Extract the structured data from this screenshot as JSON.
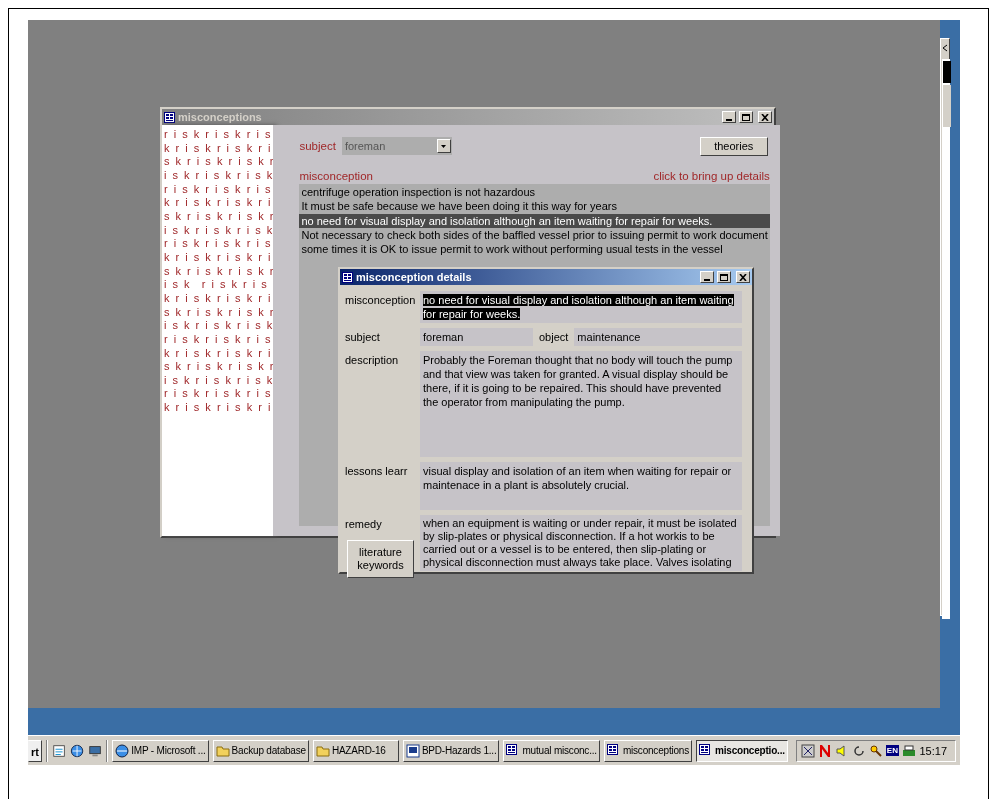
{
  "misconceptions_window": {
    "title": "misconceptions",
    "risk_pattern": [
      "r i s k r i s k r i s",
      "k r i s k r i s k r i",
      "s k r i s k r i s k r",
      "i s k r i s k r i s k",
      "r i s k r i s k r i s",
      "k r i s k r i s k r i",
      "s k r i s k r i s k r",
      "i s k r i s k r i s k",
      "r i s k r i s k r i s",
      "k r i s k r i s k r i",
      "s k r i s k r i s k r",
      "i s k  r i s k r i s",
      "k r i s k r i s k r i",
      "s k r i s k r i s k r",
      "i s k r i s k r i s k",
      "r i s k r i s k r i s",
      "k r i s k r i s k r i",
      "s k r i s k r i s k r",
      "i s k r i s k r i s k",
      "r i s k r i s k r i s",
      "k r i s k r i s k r i"
    ],
    "subject_label": "subject",
    "subject_value": "foreman",
    "theories_button": "theories",
    "misconception_label": "misconception",
    "details_hint": "click to bring up details",
    "items": [
      {
        "text": "centrifuge operation inspection is not hazardous",
        "selected": false
      },
      {
        "text": "It must be safe because we have been doing it this way for years",
        "selected": false
      },
      {
        "text": "no need for visual display and isolation although an item waiting for repair for weeks.",
        "selected": true
      },
      {
        "text": "Not necessary to check both sides of the baffled vessel prior to issuing permit to work document",
        "selected": false
      },
      {
        "text": "some times it is OK to issue permit to work without performing usual tests in the vessel",
        "selected": false
      }
    ]
  },
  "details_window": {
    "title": "misconception details",
    "misconception": {
      "label": "misconception",
      "value": "no need for visual display and isolation although an item waiting for repair for weeks.",
      "highlighted": true
    },
    "subject": {
      "label": "subject",
      "value": "foreman"
    },
    "object": {
      "label": "object",
      "value": "maintenance"
    },
    "description": {
      "label": "description",
      "value": "Probably the Foreman thought that no body will touch the pump and that view was taken for granted. A visual display should be there, if it is going to be repaired. This should have prevented the operator from manipulating the pump."
    },
    "lessons": {
      "label": "lessons learr",
      "value": "visual display and isolation of an item when waiting for repair or maintenace in a plant is absolutely crucial."
    },
    "remedy": {
      "label": "remedy",
      "value": "when an equipment is waiting or under repair, it must be isolated by slip-plates or physical disconnection. If a hot workis to be carried out or a vessel is to be entered, then slip-plating or physical disconnection must always take place. Valves isolating"
    },
    "literature_button": "literature keywords"
  },
  "taskbar": {
    "start_partial": "rt",
    "tasks": [
      {
        "label": "IMP - Microsoft ...",
        "kind": "browser",
        "selected": false
      },
      {
        "label": "Backup database",
        "kind": "folder",
        "selected": false
      },
      {
        "label": "HAZARD-16",
        "kind": "folder",
        "selected": false
      },
      {
        "label": "BPD-Hazards 1...",
        "kind": "document",
        "selected": false
      },
      {
        "label": "mutual misconc...",
        "kind": "form",
        "selected": false
      },
      {
        "label": "misconceptions",
        "kind": "form",
        "selected": false
      },
      {
        "label": "misconceptio...",
        "kind": "form",
        "selected": true
      }
    ],
    "language": "EN",
    "clock": "15:17"
  }
}
